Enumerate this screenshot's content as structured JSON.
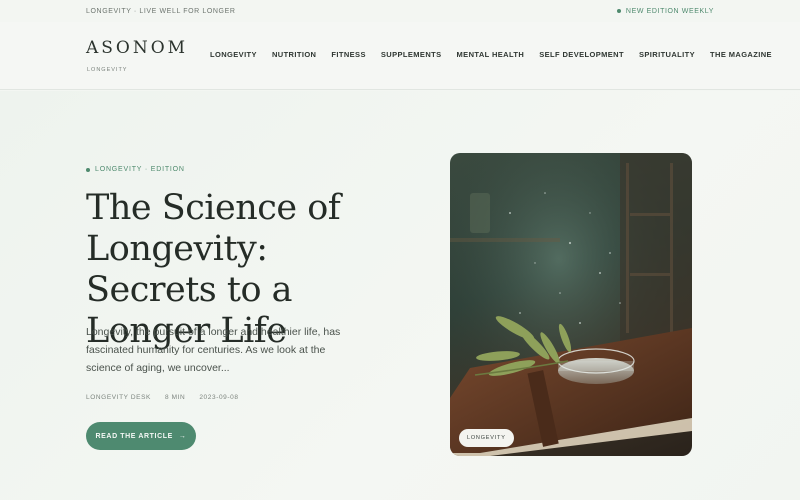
{
  "topbar": {
    "tagline": "LONGEVITY · LIVE WELL FOR LONGER",
    "edition_note": "NEW EDITION WEEKLY"
  },
  "header": {
    "logo": "ASONOM",
    "logo_sub": "LONGEVITY",
    "nav": [
      "LONGEVITY",
      "NUTRITION",
      "FITNESS",
      "SUPPLEMENTS",
      "MENTAL HEALTH",
      "SELF DEVELOPMENT",
      "SPIRITUALITY",
      "THE MAGAZINE"
    ]
  },
  "hero": {
    "kicker": "LONGEVITY · EDITION",
    "headline": "The Science of Longevity: Secrets to a Longer Life",
    "excerpt": "Longevity, the pursuit of a longer and healthier life, has fascinated humanity for centuries. As we look at the science of aging, we uncover...",
    "meta": {
      "author": "LONGEVITY DESK",
      "read_time": "8 MIN",
      "date": "2023-09-08"
    },
    "cta_label": "READ THE ARTICLE",
    "cta_arrow": "→",
    "image_badge": "LONGEVITY"
  },
  "colors": {
    "accent": "#4e8a70",
    "background": "#f3f6f2",
    "text": "#252c27"
  },
  "icons": {
    "status_dot": "dot-icon",
    "arrow": "arrow-right-icon"
  }
}
